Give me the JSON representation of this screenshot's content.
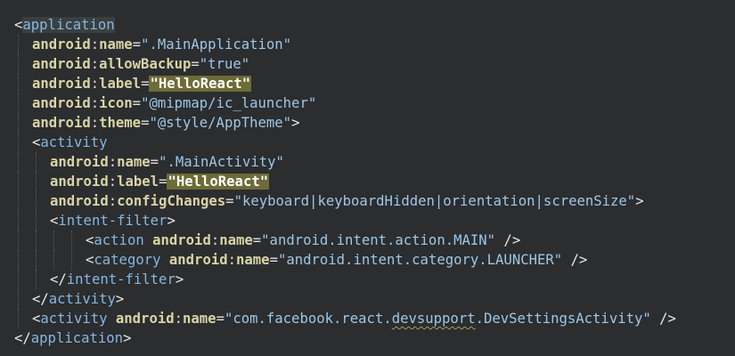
{
  "editor": {
    "lines": [
      {
        "indent": 0,
        "tokens": [
          {
            "t": "bracket",
            "v": "<"
          },
          {
            "t": "tag",
            "v": "application",
            "hl": "app"
          }
        ]
      },
      {
        "indent": 1,
        "tokens": [
          {
            "t": "ns",
            "v": "android"
          },
          {
            "t": "colon",
            "v": ":"
          },
          {
            "t": "attr",
            "v": "name"
          },
          {
            "t": "eq",
            "v": "="
          },
          {
            "t": "str",
            "v": "\".MainApplication\""
          }
        ]
      },
      {
        "indent": 1,
        "tokens": [
          {
            "t": "ns",
            "v": "android"
          },
          {
            "t": "colon",
            "v": ":"
          },
          {
            "t": "attr",
            "v": "allowBackup"
          },
          {
            "t": "eq",
            "v": "="
          },
          {
            "t": "str",
            "v": "\"true\""
          }
        ]
      },
      {
        "indent": 1,
        "tokens": [
          {
            "t": "ns",
            "v": "android"
          },
          {
            "t": "colon",
            "v": ":"
          },
          {
            "t": "attr",
            "v": "label"
          },
          {
            "t": "eq",
            "v": "="
          },
          {
            "t": "str",
            "v": "\"HelloReact\"",
            "hl": "val"
          }
        ]
      },
      {
        "indent": 1,
        "tokens": [
          {
            "t": "ns",
            "v": "android"
          },
          {
            "t": "colon",
            "v": ":"
          },
          {
            "t": "attr",
            "v": "icon"
          },
          {
            "t": "eq",
            "v": "="
          },
          {
            "t": "str",
            "v": "\"@mipmap/ic_launcher\""
          }
        ]
      },
      {
        "indent": 1,
        "tokens": [
          {
            "t": "ns",
            "v": "android"
          },
          {
            "t": "colon",
            "v": ":"
          },
          {
            "t": "attr",
            "v": "theme"
          },
          {
            "t": "eq",
            "v": "="
          },
          {
            "t": "str",
            "v": "\"@style/AppTheme\""
          },
          {
            "t": "bracket",
            "v": ">"
          }
        ]
      },
      {
        "indent": 1,
        "tokens": [
          {
            "t": "bracket",
            "v": "<"
          },
          {
            "t": "tag",
            "v": "activity"
          }
        ]
      },
      {
        "indent": 2,
        "tokens": [
          {
            "t": "ns",
            "v": "android"
          },
          {
            "t": "colon",
            "v": ":"
          },
          {
            "t": "attr",
            "v": "name"
          },
          {
            "t": "eq",
            "v": "="
          },
          {
            "t": "str",
            "v": "\".MainActivity\""
          }
        ]
      },
      {
        "indent": 2,
        "tokens": [
          {
            "t": "ns",
            "v": "android"
          },
          {
            "t": "colon",
            "v": ":"
          },
          {
            "t": "attr",
            "v": "label"
          },
          {
            "t": "eq",
            "v": "="
          },
          {
            "t": "str",
            "v": "\"HelloReact\"",
            "hl": "val"
          }
        ]
      },
      {
        "indent": 2,
        "tokens": [
          {
            "t": "ns",
            "v": "android"
          },
          {
            "t": "colon",
            "v": ":"
          },
          {
            "t": "attr",
            "v": "configChanges"
          },
          {
            "t": "eq",
            "v": "="
          },
          {
            "t": "str",
            "v": "\"keyboard|keyboardHidden|orientation|screenSize\""
          },
          {
            "t": "bracket",
            "v": ">"
          }
        ]
      },
      {
        "indent": 2,
        "tokens": [
          {
            "t": "bracket",
            "v": "<"
          },
          {
            "t": "tag",
            "v": "intent-filter"
          },
          {
            "t": "bracket",
            "v": ">"
          }
        ]
      },
      {
        "indent": 4,
        "tokens": [
          {
            "t": "bracket",
            "v": "<"
          },
          {
            "t": "tag",
            "v": "action "
          },
          {
            "t": "ns",
            "v": "android"
          },
          {
            "t": "colon",
            "v": ":"
          },
          {
            "t": "attr",
            "v": "name"
          },
          {
            "t": "eq",
            "v": "="
          },
          {
            "t": "str",
            "v": "\"android.intent.action.MAIN\""
          },
          {
            "t": "bracket",
            "v": " />"
          }
        ]
      },
      {
        "indent": 4,
        "tokens": [
          {
            "t": "bracket",
            "v": "<"
          },
          {
            "t": "tag",
            "v": "category "
          },
          {
            "t": "ns",
            "v": "android"
          },
          {
            "t": "colon",
            "v": ":"
          },
          {
            "t": "attr",
            "v": "name"
          },
          {
            "t": "eq",
            "v": "="
          },
          {
            "t": "str",
            "v": "\"android.intent.category.LAUNCHER\""
          },
          {
            "t": "bracket",
            "v": " />"
          }
        ]
      },
      {
        "indent": 2,
        "tokens": [
          {
            "t": "bracket",
            "v": "</"
          },
          {
            "t": "tag",
            "v": "intent-filter"
          },
          {
            "t": "bracket",
            "v": ">"
          }
        ]
      },
      {
        "indent": 1,
        "tokens": [
          {
            "t": "bracket",
            "v": "</"
          },
          {
            "t": "tag",
            "v": "activity"
          },
          {
            "t": "bracket",
            "v": ">"
          }
        ]
      },
      {
        "indent": 1,
        "tokens": [
          {
            "t": "bracket",
            "v": "<"
          },
          {
            "t": "tag",
            "v": "activity "
          },
          {
            "t": "ns",
            "v": "android"
          },
          {
            "t": "colon",
            "v": ":"
          },
          {
            "t": "attr",
            "v": "name"
          },
          {
            "t": "eq",
            "v": "="
          },
          {
            "t": "str",
            "v": "\"com.facebook.react."
          },
          {
            "t": "str",
            "v": "devsupport",
            "sq": true
          },
          {
            "t": "str",
            "v": ".DevSettingsActivity\""
          },
          {
            "t": "bracket",
            "v": " />"
          }
        ]
      },
      {
        "indent": 0,
        "tokens": [
          {
            "t": "bracket",
            "v": "</"
          },
          {
            "t": "tag",
            "v": "application"
          },
          {
            "t": "bracket",
            "v": ">"
          }
        ]
      }
    ]
  }
}
